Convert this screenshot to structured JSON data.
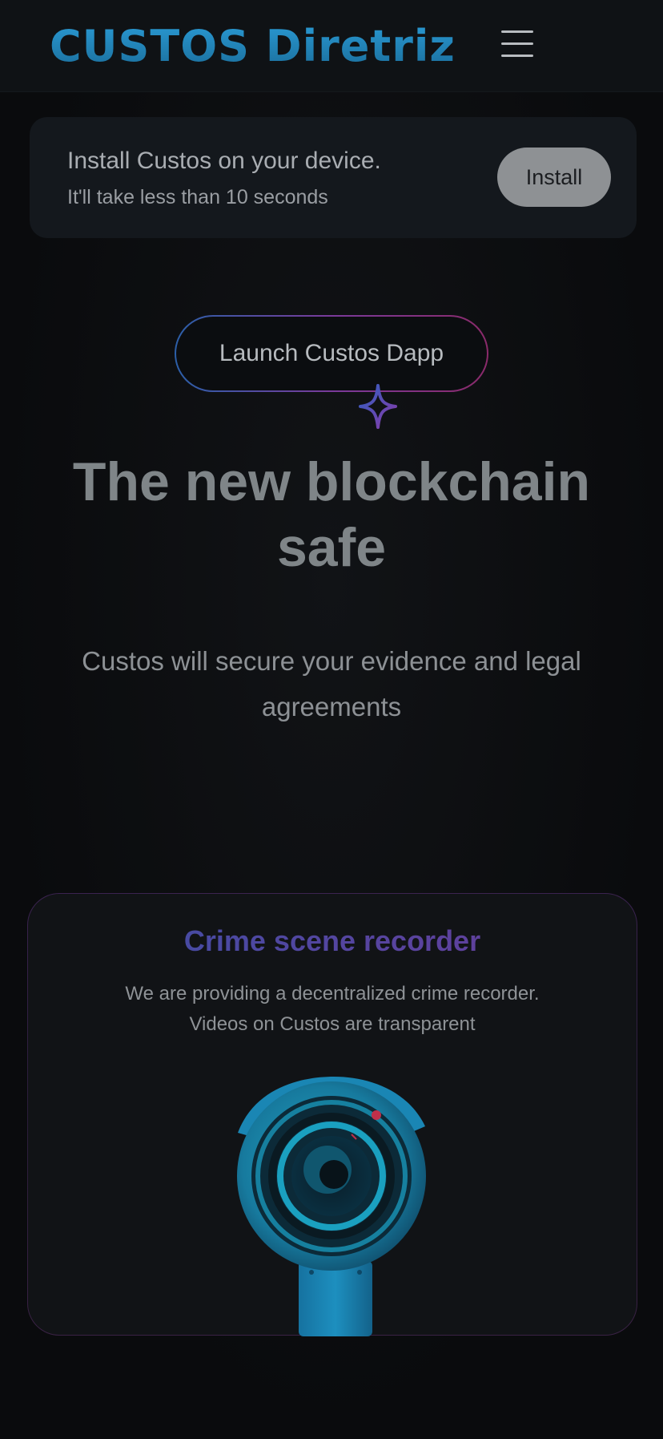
{
  "header": {
    "logo_text": "CUSTOS Diretriz",
    "menu_icon": "hamburger-menu-icon"
  },
  "install_banner": {
    "title": "Install Custos on your device.",
    "subtitle": "It'll take less than 10 seconds",
    "button_label": "Install"
  },
  "launch": {
    "label": "Launch Custos Dapp",
    "sparkle_icon": "sparkle-icon"
  },
  "hero": {
    "title_line1": "The new blockchain",
    "title_line2": "safe",
    "subtitle": "Custos will secure your evidence and legal agreements"
  },
  "feature": {
    "title": "Crime scene recorder",
    "desc_line1": "We are providing a decentralized crime recorder.",
    "desc_line2": "Videos on Custos are transparent",
    "image_icon": "security-camera-icon"
  },
  "colors": {
    "background": "#0a0b0d",
    "logo": "#1f7fb0",
    "accent_gradient_start": "#3c4fa5",
    "accent_gradient_end": "#6a3c9a",
    "install_button": "#8e9194"
  }
}
